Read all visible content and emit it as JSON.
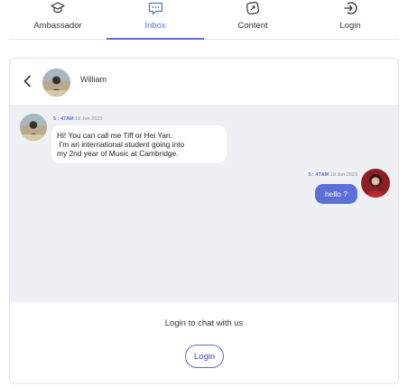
{
  "nav": {
    "tabs": [
      {
        "label": "Ambassador",
        "icon": "graduation-cap-icon"
      },
      {
        "label": "Inbox",
        "icon": "chat-message-icon",
        "active": true
      },
      {
        "label": "Content",
        "icon": "content-icon"
      },
      {
        "label": "Login",
        "icon": "login-icon"
      }
    ]
  },
  "chat": {
    "header": {
      "name": "William"
    },
    "messages": [
      {
        "direction": "incoming",
        "time": "5 : 47AM",
        "date": "19 Jun 2023",
        "lines": [
          "Hi! You can call me Tiff or Hei Yan.",
          " I'm an international student going into",
          "my 2nd year of Music at Cambridge."
        ]
      },
      {
        "direction": "outgoing",
        "time": "5 : 47AM",
        "date": "19 Jun 2023",
        "text": "hello ?"
      }
    ]
  },
  "footer": {
    "prompt": "Login to chat with us",
    "login_label": "Login"
  },
  "colors": {
    "accent": "#5b6fd6",
    "chat_background": "#eef0f3"
  }
}
